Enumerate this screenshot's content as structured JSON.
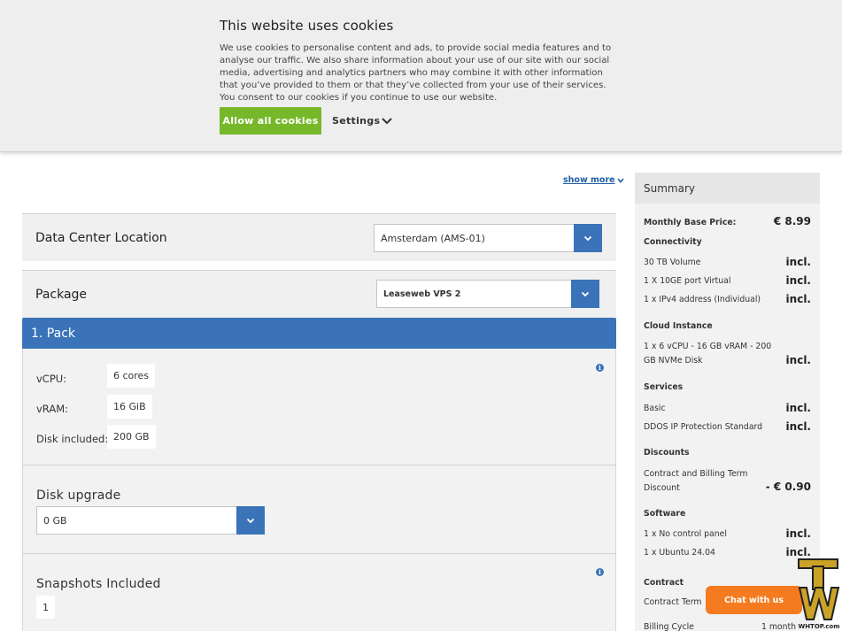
{
  "cookie": {
    "title": "This website uses cookies",
    "text": "We use cookies to personalise content and ads, to provide social media features and to analyse our traffic. We also share information about your use of our site with our social media, advertising and analytics partners who may combine it with other information that you’ve provided to them or that they’ve collected from your use of their services. You consent to our cookies if you continue to use our website.",
    "allow_label": "Allow all cookies",
    "settings_label": "Settings"
  },
  "show_more": "show more",
  "datacenter": {
    "title": "Data Center Location",
    "value": "Amsterdam (AMS-01)"
  },
  "package": {
    "title": "Package",
    "value": "Leaseweb VPS 2"
  },
  "pack": {
    "title": "1. Pack",
    "specs": [
      {
        "label": "vCPU:",
        "value": "6 cores"
      },
      {
        "label": "vRAM:",
        "value": "16 GiB"
      },
      {
        "label": "Disk included:",
        "value": "200 GB"
      }
    ]
  },
  "disk_upgrade": {
    "title": "Disk upgrade",
    "value": "0 GB"
  },
  "snapshots": {
    "title": "Snapshots Included",
    "value": "1"
  },
  "summary": {
    "title": "Summary",
    "base_label": "Monthly Base Price:",
    "base_value": "€ 8.99",
    "connectivity": {
      "heading": "Connectivity",
      "rows": [
        {
          "label": "30 TB Volume",
          "value": "incl."
        },
        {
          "label": "1 X 10GE port Virtual",
          "value": "incl."
        },
        {
          "label": "1 x IPv4 address (Individual)",
          "value": "incl."
        }
      ]
    },
    "cloud": {
      "heading": "Cloud Instance",
      "label": "1 x 6 vCPU - 16 GB vRAM - 200 GB NVMe Disk",
      "value": "incl."
    },
    "services": {
      "heading": "Services",
      "rows": [
        {
          "label": "Basic",
          "value": "incl."
        },
        {
          "label": "DDOS IP Protection Standard",
          "value": "incl."
        }
      ]
    },
    "discounts": {
      "heading": "Discounts",
      "label": "Contract and Billing Term Discount",
      "value": "- € 0.90"
    },
    "software": {
      "heading": "Software",
      "rows": [
        {
          "label": "1 x No control panel",
          "value": "incl."
        },
        {
          "label": "1 x Ubuntu 24.04",
          "value": "incl."
        }
      ]
    },
    "contract": {
      "heading": "Contract",
      "term_label": "Contract Term",
      "billing_label": "Billing Cycle",
      "billing_value": "1 month"
    }
  },
  "chat_label": "Chat with us",
  "watermark": {
    "text": "WHTOP.com"
  },
  "colors": {
    "accent_blue": "#3a73b8",
    "allow_green": "#76b82a",
    "chat_orange": "#f47b20"
  }
}
